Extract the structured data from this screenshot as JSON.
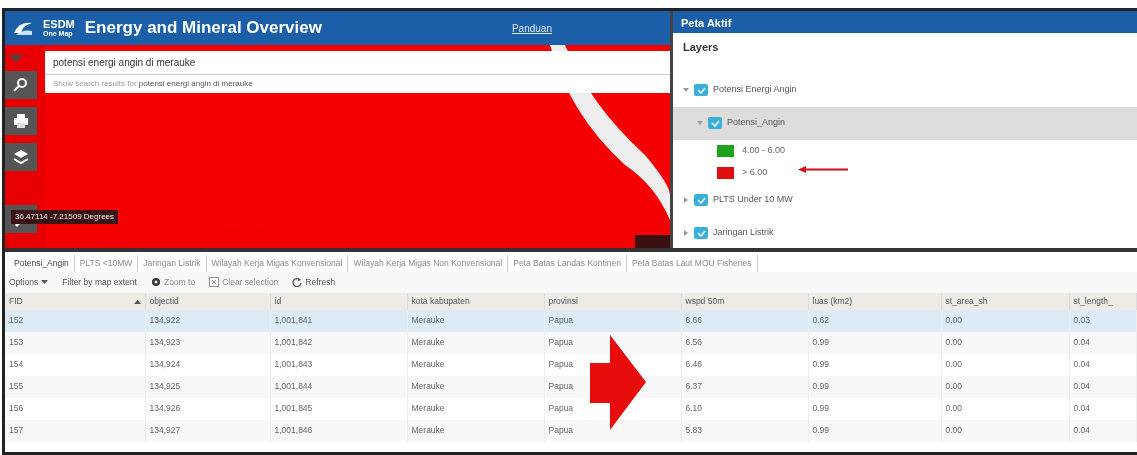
{
  "app": {
    "logo_top": "ESDM",
    "logo_bottom": "One Map",
    "title": "Energy and Mineral Overview",
    "help_link": "Panduan"
  },
  "search": {
    "value": "potensi energi angin di merauke",
    "suggestion_prefix": "Show search results for",
    "suggestion_query": "potensi energi angin di merauke"
  },
  "map": {
    "coordinates": "36.47114 -7.21509 Degrees"
  },
  "panel": {
    "title": "Peta Aktif",
    "heading": "Layers",
    "layers": [
      {
        "label": "Potensi Energi Angin",
        "checked": true,
        "expanded": true,
        "selected": false,
        "children": [
          {
            "label": "Potensi_Angin",
            "checked": true,
            "expanded": true,
            "selected": true,
            "legend": [
              {
                "label": "4.00 - 6.00",
                "color": "#1fa31f"
              },
              {
                "label": "> 6.00",
                "color": "#e01010"
              }
            ]
          }
        ]
      },
      {
        "label": "PLTS Under 10 MW",
        "checked": true,
        "expanded": false,
        "selected": false
      },
      {
        "label": "Jaringan Listrik",
        "checked": true,
        "expanded": false,
        "selected": false
      }
    ]
  },
  "table_tabs": [
    {
      "label": "Potensi_Angin",
      "selected": true
    },
    {
      "label": "PLTS <10MW",
      "selected": false
    },
    {
      "label": "Jaringan Listrik",
      "selected": false
    },
    {
      "label": "Wilayah Kerja Migas Konvensional",
      "selected": false
    },
    {
      "label": "Wilayah Kerja Migas Non Konvensional",
      "selected": false
    },
    {
      "label": "Peta Batas Landas Kontinen",
      "selected": false
    },
    {
      "label": "Peta Batas Laut MOU Fisheries",
      "selected": false
    }
  ],
  "toolbar": [
    {
      "kind": "menu",
      "label": "Options",
      "disabled": false
    },
    {
      "kind": "plain",
      "label": "Filter by map extent",
      "disabled": false
    },
    {
      "kind": "zoom",
      "label": "Zoom to",
      "disabled": true
    },
    {
      "kind": "clear",
      "label": "Clear selection",
      "disabled": true
    },
    {
      "kind": "refresh",
      "label": "Refresh",
      "disabled": false
    }
  ],
  "table": {
    "columns": [
      "FID",
      "objectid",
      "id",
      "kota kabupaten",
      "provinsi",
      "wspd 50m",
      "luas (km2)",
      "st_area_sh",
      "st_length_"
    ],
    "rows": [
      {
        "selected": true,
        "cells": [
          "152",
          "134,922",
          "1,001,841",
          "Merauke",
          "Papua",
          "6.66",
          "0.62",
          "0.00",
          "0.03"
        ]
      },
      {
        "selected": false,
        "cells": [
          "153",
          "134,923",
          "1,001,842",
          "Merauke",
          "Papua",
          "6.56",
          "0.99",
          "0.00",
          "0.04"
        ]
      },
      {
        "selected": false,
        "cells": [
          "154",
          "134,924",
          "1,001,843",
          "Merauke",
          "Papua",
          "6.46",
          "0.99",
          "0.00",
          "0.04"
        ]
      },
      {
        "selected": false,
        "cells": [
          "155",
          "134,925",
          "1,001,844",
          "Merauke",
          "Papua",
          "6.37",
          "0.99",
          "0.00",
          "0.04"
        ]
      },
      {
        "selected": false,
        "cells": [
          "156",
          "134,926",
          "1,001,845",
          "Merauke",
          "Papua",
          "6.10",
          "0.99",
          "0.00",
          "0.04"
        ]
      },
      {
        "selected": false,
        "cells": [
          "157",
          "134,927",
          "1,001,846",
          "Merauke",
          "Papua",
          "5.83",
          "0.99",
          "0.00",
          "0.04"
        ]
      }
    ]
  }
}
